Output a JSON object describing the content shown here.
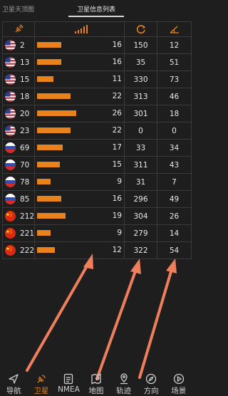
{
  "tabs": [
    {
      "label": "卫星天顶图",
      "active": false
    },
    {
      "label": "卫星信息列表",
      "active": true
    }
  ],
  "table": {
    "header_icons": [
      "satellite-icon",
      "signal-strength-icon",
      "azimuth-icon",
      "elevation-icon"
    ],
    "snr_max": 26,
    "rows": [
      {
        "flag": "us",
        "prn": "2",
        "snr": "16",
        "azimuth": "150",
        "elevation": "12"
      },
      {
        "flag": "us",
        "prn": "13",
        "snr": "16",
        "azimuth": "35",
        "elevation": "51"
      },
      {
        "flag": "us",
        "prn": "15",
        "snr": "11",
        "azimuth": "330",
        "elevation": "73"
      },
      {
        "flag": "us",
        "prn": "18",
        "snr": "22",
        "azimuth": "313",
        "elevation": "46"
      },
      {
        "flag": "us",
        "prn": "20",
        "snr": "26",
        "azimuth": "301",
        "elevation": "18"
      },
      {
        "flag": "us",
        "prn": "23",
        "snr": "22",
        "azimuth": "0",
        "elevation": "0"
      },
      {
        "flag": "ru",
        "prn": "69",
        "snr": "17",
        "azimuth": "33",
        "elevation": "34"
      },
      {
        "flag": "ru",
        "prn": "70",
        "snr": "15",
        "azimuth": "311",
        "elevation": "43"
      },
      {
        "flag": "ru",
        "prn": "78",
        "snr": "9",
        "azimuth": "31",
        "elevation": "7"
      },
      {
        "flag": "ru",
        "prn": "85",
        "snr": "16",
        "azimuth": "296",
        "elevation": "49"
      },
      {
        "flag": "cn",
        "prn": "212",
        "snr": "19",
        "azimuth": "304",
        "elevation": "26"
      },
      {
        "flag": "cn",
        "prn": "221",
        "snr": "9",
        "azimuth": "279",
        "elevation": "14"
      },
      {
        "flag": "cn",
        "prn": "222",
        "snr": "12",
        "azimuth": "322",
        "elevation": "54"
      }
    ]
  },
  "nav": [
    {
      "label": "导航",
      "icon": "navigation-icon",
      "active": false
    },
    {
      "label": "卫星",
      "icon": "satellite-icon",
      "active": true
    },
    {
      "label": "NMEA",
      "icon": "nmea-document-icon",
      "active": false
    },
    {
      "label": "地图",
      "icon": "map-icon",
      "active": false
    },
    {
      "label": "轨迹",
      "icon": "track-pin-icon",
      "active": false
    },
    {
      "label": "方向",
      "icon": "compass-icon",
      "active": false
    },
    {
      "label": "场景",
      "icon": "scene-play-icon",
      "active": false
    }
  ],
  "colors": {
    "accent": "#e7821d",
    "background": "#1e1e1e",
    "arrow": "#ef7e5c"
  }
}
